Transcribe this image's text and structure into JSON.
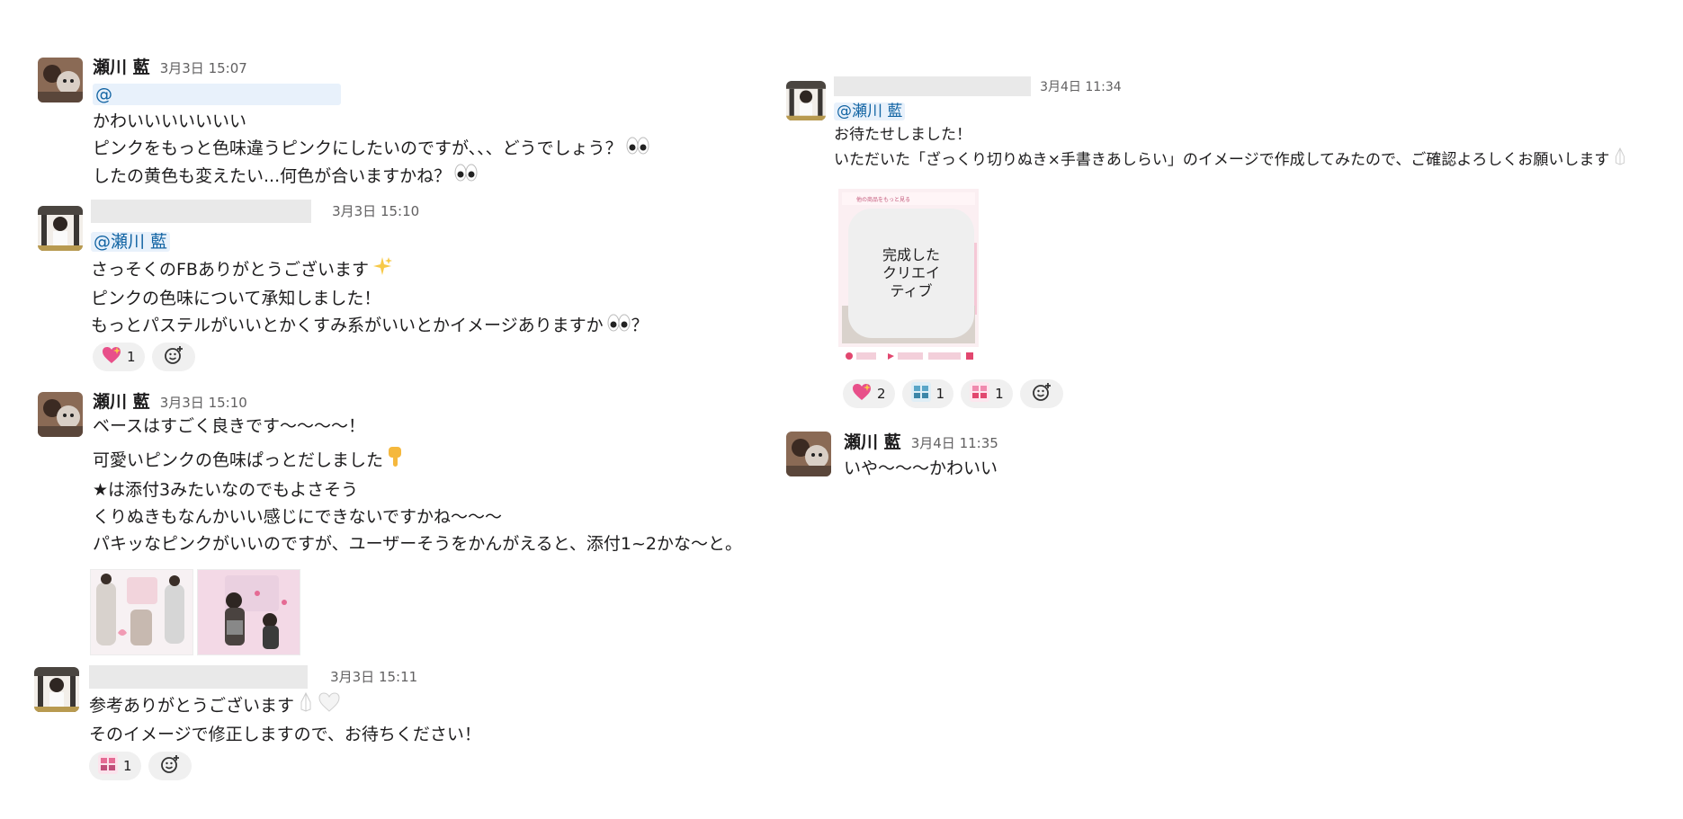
{
  "messages": {
    "m1": {
      "name": "瀬川 藍",
      "time": "3月3日 15:07",
      "mention": "@",
      "lines": [
        "かわいいいいいいい",
        "ピンクをもっと色味違うピンクにしたいのですが、、、どうでしょう？",
        "したの黄色も変えたい...何色が合いますかね？"
      ]
    },
    "m2": {
      "time": "3月3日 15:10",
      "mention": "@瀬川 藍",
      "lines": [
        "さっそくのFBありがとうございます",
        "ピンクの色味について承知しました！",
        "もっとパステルがいいとかくすみ系がいいとかイメージありますか",
        "？"
      ],
      "reaction_count": "1"
    },
    "m3": {
      "name": "瀬川 藍",
      "time": "3月3日 15:10",
      "lines": [
        "ベースはすごく良きです〜〜〜〜！",
        "可愛いピンクの色味ぱっとだしました",
        "★は添付3みたいなのでもよさそう",
        "くりぬきもなんかいい感じにできないですかね〜〜〜",
        "パキッなピンクがいいのですが、ユーザーそうをかんがえると、添付1~2かな〜と。"
      ]
    },
    "m4": {
      "time": "3月3日 15:11",
      "lines": [
        "参考ありがとうございます",
        "そのイメージで修正しますので、お待ちください！"
      ],
      "reaction_count": "1"
    },
    "m5": {
      "time": "3月4日 11:34",
      "mention": "@瀬川 藍",
      "lines": [
        "お待たせしました！",
        "いただいた「ざっくり切りぬき×手書きあしらい」のイメージで作成してみたので、ご確認よろしくお願いします"
      ],
      "image_label": "完成した\nクリエイ\nティブ",
      "image_header": "他の商品をもっと見る",
      "reaction_counts": [
        "2",
        "1",
        "1"
      ]
    },
    "m6": {
      "name": "瀬川 藍",
      "time": "3月4日 11:35",
      "lines": [
        "いや〜〜〜かわいい"
      ]
    }
  },
  "colors": {
    "mention_bg": "#e8f1fb",
    "mention_text": "#1264a3",
    "reaction_bg": "#f0f0f0",
    "redaction": "#e9e9e9"
  },
  "icons": [
    "heart-sparkle-emoji",
    "eyes-emoji",
    "sparkles-emoji",
    "pointing-down-emoji",
    "praying-hands-emoji",
    "white-heart-emoji",
    "add-reaction-icon",
    "custom-stamp-icon"
  ]
}
